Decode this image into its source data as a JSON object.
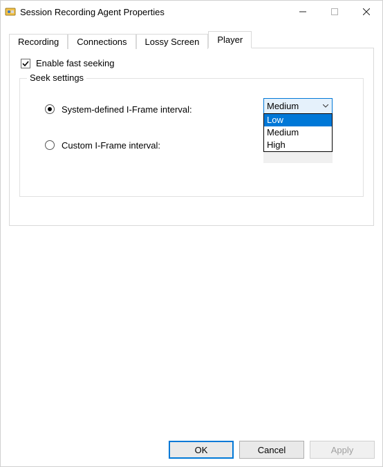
{
  "window": {
    "title": "Session Recording Agent Properties"
  },
  "tabs": [
    {
      "label": "Recording",
      "active": false
    },
    {
      "label": "Connections",
      "active": false
    },
    {
      "label": "Lossy Screen",
      "active": false
    },
    {
      "label": "Player",
      "active": true
    }
  ],
  "player_panel": {
    "enable_fast_seeking": {
      "label": "Enable fast seeking",
      "checked": true
    },
    "fieldset_title": "Seek settings",
    "radio_system": {
      "label": "System-defined I-Frame interval:",
      "selected": true
    },
    "radio_custom": {
      "label": "Custom I-Frame interval:",
      "selected": false
    },
    "interval_level": {
      "value": "Medium",
      "options": [
        "Low",
        "Medium",
        "High"
      ],
      "highlighted_option": "Low",
      "expanded": true
    }
  },
  "buttons": {
    "ok": "OK",
    "cancel": "Cancel",
    "apply": "Apply"
  }
}
